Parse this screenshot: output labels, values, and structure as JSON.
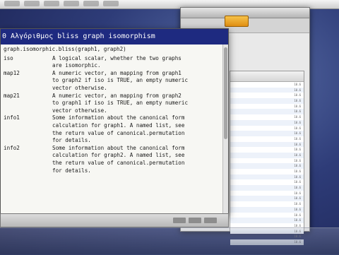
{
  "window": {
    "title": "0 Αλγόριθμος bliss graph isomorphism"
  },
  "help": {
    "usage": "graph.isomorphic.bliss(graph1, graph2)",
    "args": [
      {
        "name": "iso",
        "desc": [
          "A logical scalar, whether the two graphs",
          "are isomorphic."
        ]
      },
      {
        "name": "map12",
        "desc": [
          "A numeric vector, an mapping from graph1",
          "to graph2 if iso is TRUE, an empty numeric",
          "vector otherwise."
        ]
      },
      {
        "name": "map21",
        "desc": [
          "A numeric vector, an mapping from graph2",
          "to graph1 if iso is TRUE, an empty numeric",
          "vector otherwise."
        ]
      },
      {
        "name": "info1",
        "desc": [
          "Some information about the canonical form",
          "calculation for graph1. A named list, see",
          "the return value of canonical.permutation",
          "for details."
        ]
      },
      {
        "name": "info2",
        "desc": [
          "Some information about the canonical form",
          "calculation for graph2. A named list, see",
          "the return value of canonical.permutation",
          "for details."
        ]
      }
    ]
  },
  "activity": {
    "rows": [
      [
        "",
        "10.6"
      ],
      [
        "",
        "10.6"
      ],
      [
        "",
        "10.6"
      ],
      [
        "",
        "10.6"
      ],
      [
        "",
        "10.6"
      ],
      [
        "",
        "10.6"
      ],
      [
        "",
        "10.6"
      ],
      [
        "",
        "10.6"
      ],
      [
        "",
        "10.6"
      ],
      [
        "",
        "10.6"
      ],
      [
        "",
        "10.6"
      ],
      [
        "",
        "10.6"
      ],
      [
        "",
        "10.6"
      ],
      [
        "",
        "10.6"
      ],
      [
        "",
        "10.6"
      ],
      [
        "",
        "10.6"
      ],
      [
        "",
        "10.6"
      ],
      [
        "",
        "10.6"
      ],
      [
        "",
        "10.6"
      ],
      [
        "",
        "10.6"
      ],
      [
        "",
        "10.6"
      ],
      [
        "",
        "10.6"
      ],
      [
        "",
        "10.6"
      ],
      [
        "",
        "10.6"
      ],
      [
        "",
        "10.6"
      ],
      [
        "",
        "10.6"
      ],
      [
        "",
        "10.6"
      ],
      [
        "",
        "10.6"
      ],
      [
        "",
        "10.6"
      ],
      [
        "",
        "10.6"
      ]
    ]
  }
}
